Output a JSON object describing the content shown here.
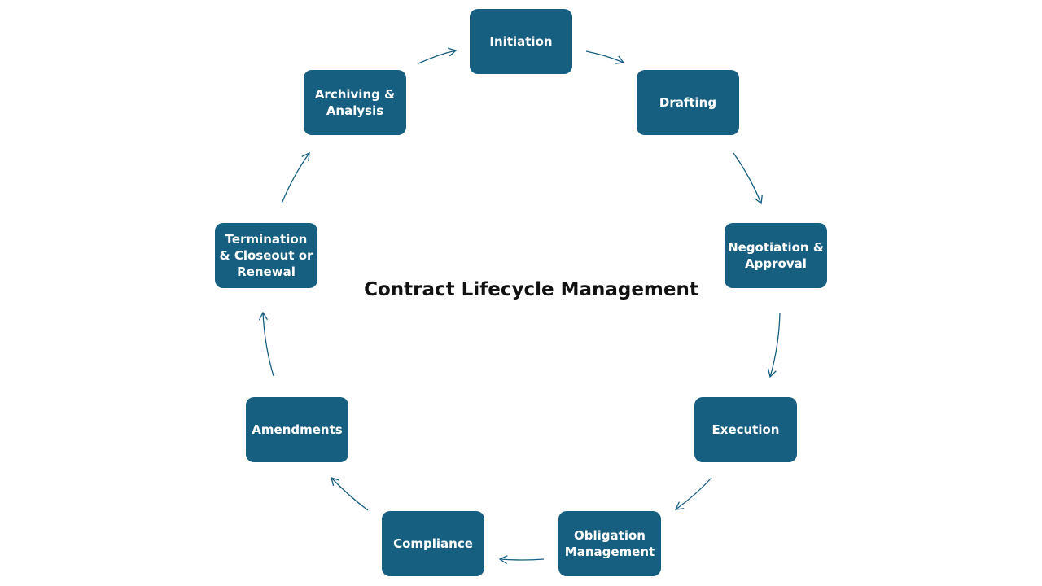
{
  "title": "Contract Lifecycle Management",
  "stages": [
    {
      "id": "initiation",
      "label": "Initiation"
    },
    {
      "id": "drafting",
      "label": "Drafting"
    },
    {
      "id": "negotiation",
      "label": "Negotiation & Approval"
    },
    {
      "id": "execution",
      "label": "Execution"
    },
    {
      "id": "obligation",
      "label": "Obligation Management"
    },
    {
      "id": "compliance",
      "label": "Compliance"
    },
    {
      "id": "amendments",
      "label": "Amendments"
    },
    {
      "id": "termination",
      "label": "Termination & Closeout or Renewal"
    },
    {
      "id": "archiving",
      "label": "Archiving & Analysis"
    }
  ],
  "colors": {
    "node": "#175f80",
    "arrow": "#175f80",
    "text": "#ffffff"
  }
}
